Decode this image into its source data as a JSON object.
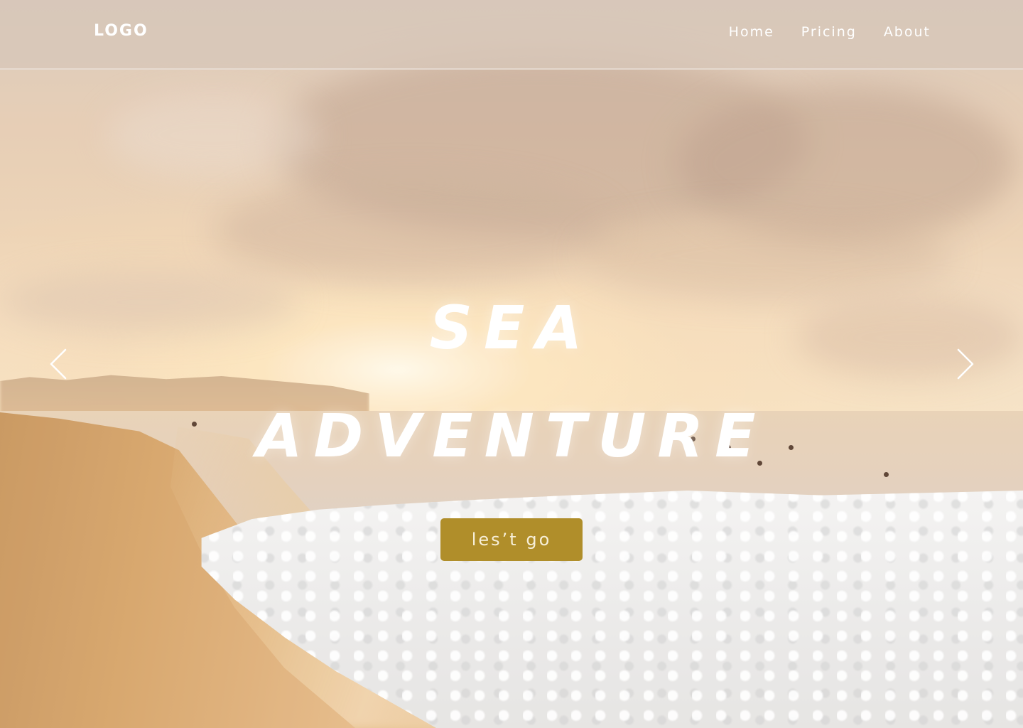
{
  "navbar": {
    "logo": "LOGO",
    "links": [
      {
        "label": "Home"
      },
      {
        "label": "Pricing"
      },
      {
        "label": "About"
      }
    ]
  },
  "hero": {
    "title_line_1": "SEA",
    "title_line_2": "ADVENTURE",
    "cta_label": "les’t go"
  },
  "carousel": {
    "prev_icon": "chevron-left-icon",
    "next_icon": "chevron-right-icon"
  },
  "colors": {
    "cta_background": "#b08e2a",
    "cta_text": "#f7efd9",
    "navbar_background": "#d7c6b9",
    "text_primary": "#ffffff"
  }
}
